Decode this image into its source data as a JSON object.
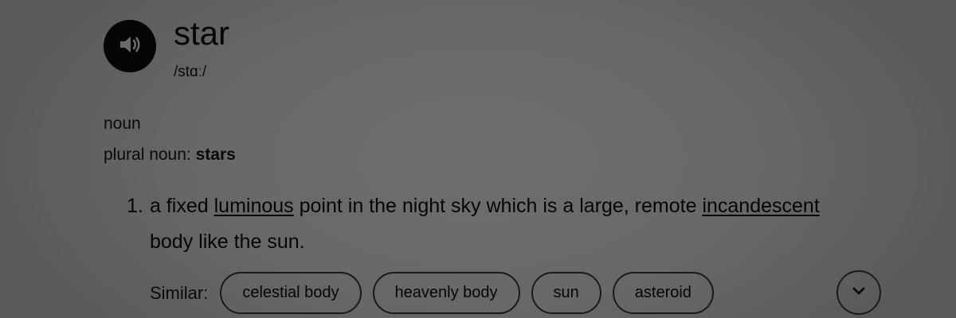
{
  "entry": {
    "word": "star",
    "phonetic": "/stɑː/",
    "part_of_speech": "noun",
    "plural_label": "plural noun: ",
    "plural_form": "stars"
  },
  "sense": {
    "number": "1.",
    "text_1": "a fixed ",
    "link_1": "luminous",
    "text_2": " point in the night sky which is a large, remote ",
    "link_2": "incandescent",
    "text_3": " body like the sun."
  },
  "similar": {
    "label": "Similar:",
    "items": [
      "celestial body",
      "heavenly body",
      "sun",
      "asteroid"
    ]
  },
  "icons": {
    "audio": "speaker-icon",
    "expand": "chevron-down-icon"
  },
  "colors": {
    "background": "#6a6a6a",
    "text": "#050505",
    "audio_button": "#050505"
  }
}
